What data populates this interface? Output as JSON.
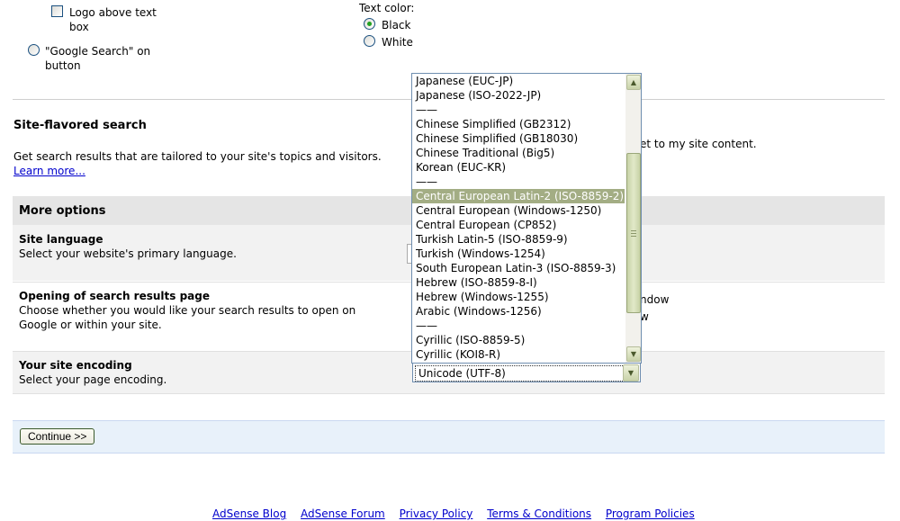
{
  "logo_options": {
    "logo_above_label_1": "Logo above text",
    "logo_above_label_2": "box",
    "google_search_label_1": "\"Google Search\" on",
    "google_search_label_2": "button"
  },
  "text_color": {
    "label": "Text color:",
    "options": [
      "Black",
      "White"
    ],
    "selected": "Black"
  },
  "site_flavored": {
    "title": "Site-flavored search",
    "description": "Get search results that are tailored to your site's topics and visitors.",
    "learn_more": "Learn more...",
    "partial_right_text": "et to my site content."
  },
  "more_options": {
    "title": "More options",
    "site_language": {
      "title": "Site language",
      "description": "Select your website's primary language."
    },
    "opening_results": {
      "title": "Opening of search results page",
      "description_1": "Choose whether you would like your search results to open on",
      "description_2": "Google or within your site.",
      "partial_right_1": "ndow",
      "partial_right_2": "w"
    },
    "encoding": {
      "title": "Your site encoding",
      "description": "Select your page encoding.",
      "selected_value": "Unicode (UTF-8)",
      "options": [
        "Japanese (EUC-JP)",
        "Japanese (ISO-2022-JP)",
        "——",
        "Chinese Simplified (GB2312)",
        "Chinese Simplified (GB18030)",
        "Chinese Traditional (Big5)",
        "Korean (EUC-KR)",
        "——",
        "Central European Latin-2 (ISO-8859-2)",
        "Central European (Windows-1250)",
        "Central European (CP852)",
        "Turkish Latin-5 (ISO-8859-9)",
        "Turkish (Windows-1254)",
        "South European Latin-3 (ISO-8859-3)",
        "Hebrew (ISO-8859-8-I)",
        "Hebrew (Windows-1255)",
        "Arabic (Windows-1256)",
        "——",
        "Cyrillic (ISO-8859-5)",
        "Cyrillic (KOI8-R)"
      ],
      "highlighted": "Central European Latin-2 (ISO-8859-2)"
    }
  },
  "continue_button": "Continue >>",
  "footer_links": [
    "AdSense Blog",
    "AdSense Forum",
    "Privacy Policy",
    "Terms & Conditions",
    "Program Policies"
  ],
  "colors": {
    "highlight": "#a3ad84",
    "link": "#0000cc",
    "band_grey": "#e5e5e5",
    "band_blue": "#e8f1fa"
  }
}
